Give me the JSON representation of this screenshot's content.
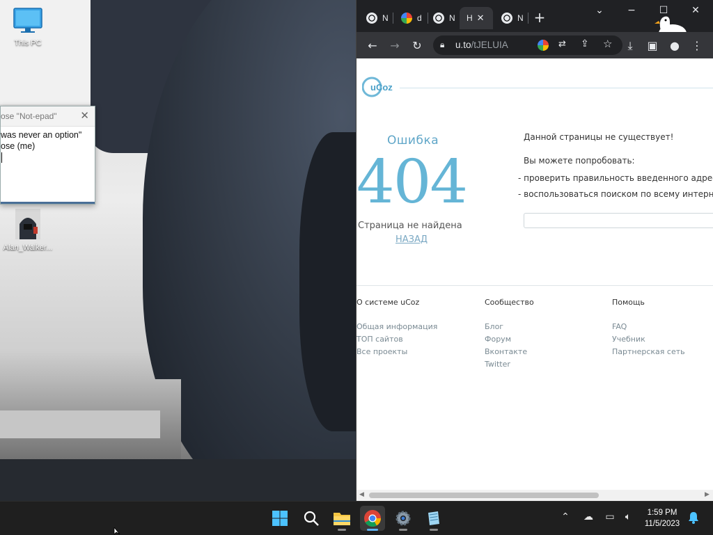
{
  "desktop": {
    "icons": [
      {
        "label": "This PC"
      },
      {
        "label": "Alan_Walker..."
      }
    ]
  },
  "notepad": {
    "title": "ose \"Not-epad\"",
    "lines": [
      "was never an option\"",
      "ose (me)"
    ]
  },
  "browser": {
    "tabs": [
      {
        "label": "N",
        "favicon": "chrome-icon"
      },
      {
        "label": "d",
        "favicon": "google-icon"
      },
      {
        "label": "N",
        "favicon": "chrome-icon"
      },
      {
        "label": "H",
        "favicon": "none",
        "active": true
      },
      {
        "label": "N",
        "favicon": "chrome-icon"
      }
    ],
    "url_host": "u.to",
    "url_path": "/tJELUIA",
    "page": {
      "logo_text": "uCoz",
      "error_word": "Ошибка",
      "error_code": "404",
      "not_found": "Страница не найдена",
      "back_link": "НАЗАД",
      "right_title": "Данной страницы не существует!",
      "right_try": "Вы можете попробовать:",
      "right_item1": "- проверить правильность введенного адрес",
      "right_item2": "- воспользоваться поиском по всему интерне",
      "footer": {
        "col1": {
          "head": "О системе uCoz",
          "links": [
            "Общая информация",
            "ТОП сайтов",
            "Все проекты"
          ]
        },
        "col2": {
          "head": "Сообщество",
          "links": [
            "Блог",
            "Форум",
            "Вконтакте",
            "Twitter"
          ]
        },
        "col3": {
          "head": "Помощь",
          "links": [
            "FAQ",
            "Учебник",
            "Партнерская сеть"
          ]
        }
      }
    }
  },
  "taskbar": {
    "time": "1:59 PM",
    "date": "11/5/2023",
    "accent": "#5fb2f2"
  }
}
